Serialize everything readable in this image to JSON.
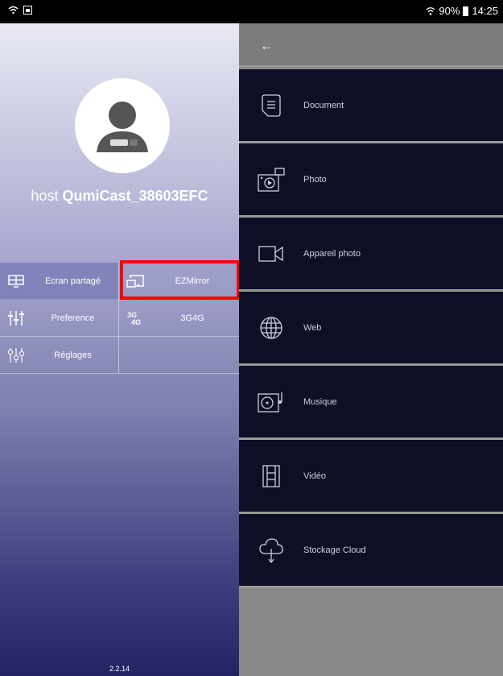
{
  "statusbar": {
    "battery": "90%",
    "time": "14:25"
  },
  "drawer": {
    "host_prefix": "host",
    "host_name": "QumiCast_38603EFC",
    "menu": [
      {
        "label": "Ecran partagé",
        "icon": "split-screen-icon"
      },
      {
        "label": "EZMirror",
        "icon": "cast-icon"
      },
      {
        "label": "Preference",
        "icon": "sliders-icon"
      },
      {
        "label": "3G4G",
        "icon": "3g4g-icon"
      },
      {
        "label": "Réglages",
        "icon": "settings-sliders-icon"
      }
    ],
    "version": "2.2.14"
  },
  "panel": {
    "items": [
      {
        "label": "Document",
        "icon": "document-icon"
      },
      {
        "label": "Photo",
        "icon": "photo-icon"
      },
      {
        "label": "Appareil photo",
        "icon": "video-camera-icon"
      },
      {
        "label": "Web",
        "icon": "globe-icon"
      },
      {
        "label": "Musique",
        "icon": "music-icon"
      },
      {
        "label": "Vidéo",
        "icon": "film-icon"
      },
      {
        "label": "Stockage Cloud",
        "icon": "cloud-icon"
      }
    ]
  },
  "colors": {
    "highlight": "#ff0000",
    "panel_item_bg": "#0e0e24",
    "panel_bg": "#8a8a8a"
  }
}
